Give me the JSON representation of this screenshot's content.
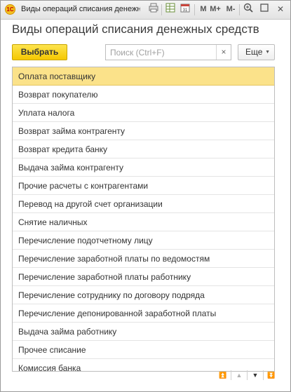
{
  "window": {
    "app_badge": "1С",
    "title": "Виды операций списания денежных",
    "toolbar": {
      "m": "M",
      "m_plus": "M+",
      "m_minus": "M-",
      "print_icon": "print-icon",
      "calendar_icon": "calendar-icon",
      "zoom_icon": "zoom-icon",
      "restore_icon": "restore-icon",
      "close": "✕"
    }
  },
  "form": {
    "title": "Виды операций списания денежных средств",
    "select_button": "Выбрать",
    "search": {
      "placeholder": "Поиск (Ctrl+F)",
      "value": "",
      "clear": "×"
    },
    "more_button": "Еще"
  },
  "list": {
    "selected_index": 0,
    "items": [
      "Оплата поставщику",
      "Возврат покупателю",
      "Уплата налога",
      "Возврат займа контрагенту",
      "Возврат кредита банку",
      "Выдача займа контрагенту",
      "Прочие расчеты с контрагентами",
      "Перевод на другой счет организации",
      "Снятие наличных",
      "Перечисление подотчетному лицу",
      "Перечисление заработной платы по ведомостям",
      "Перечисление заработной платы работнику",
      "Перечисление сотруднику по договору подряда",
      "Перечисление депонированной заработной платы",
      "Выдача займа работнику",
      "Прочее списание",
      "Комиссия банка"
    ]
  },
  "navigation": {
    "first": "⏫",
    "prev": "▲",
    "next": "▼",
    "last": "⏬"
  }
}
